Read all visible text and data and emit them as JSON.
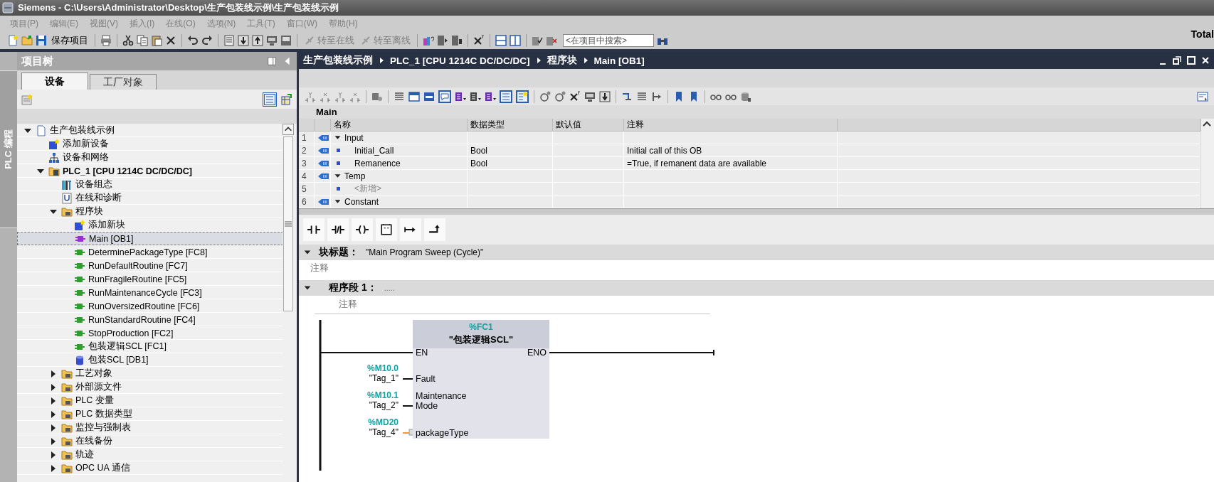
{
  "window": {
    "title": "Siemens  -  C:\\Users\\Administrator\\Desktop\\生产包装线示例\\生产包装线示例"
  },
  "menu": [
    {
      "label": "项目(P)",
      "disabled": true
    },
    {
      "label": "编辑(E)",
      "disabled": true
    },
    {
      "label": "视图(V)",
      "disabled": true
    },
    {
      "label": "插入(I)",
      "disabled": true
    },
    {
      "label": "在线(O)",
      "disabled": true
    },
    {
      "label": "选项(N)",
      "disabled": true
    },
    {
      "label": "工具(T)",
      "disabled": true
    },
    {
      "label": "窗口(W)",
      "disabled": true
    },
    {
      "label": "帮助(H)",
      "disabled": true
    }
  ],
  "toolbar": {
    "save_label": "保存项目",
    "buttons": [
      {
        "label": "转至在线",
        "disabled": true
      },
      {
        "label": "转至离线",
        "disabled": true
      }
    ],
    "search": {
      "placeholder": "<在项目中搜索>"
    },
    "right_label": "Total"
  },
  "side_tab": {
    "label": "PLC 编程"
  },
  "tree": {
    "title": "项目树",
    "tabs": [
      {
        "label": "设备",
        "selected": true
      },
      {
        "label": "工厂对象",
        "selected": false
      }
    ],
    "items": [
      {
        "label": "生产包装线示例",
        "kind": "project",
        "expanded": true,
        "selected": false,
        "children": [
          {
            "label": "添加新设备",
            "kind": "add",
            "selected": false
          },
          {
            "label": "设备和网络",
            "kind": "network",
            "selected": false
          },
          {
            "label": "PLC_1 [CPU 1214C DC/DC/DC]",
            "kind": "device",
            "expanded": true,
            "selected": false,
            "children": [
              {
                "label": "设备组态",
                "kind": "config",
                "selected": false
              },
              {
                "label": "在线和诊断",
                "kind": "diagnostics",
                "selected": false
              },
              {
                "label": "程序块",
                "kind": "folder",
                "expanded": true,
                "selected": false,
                "children": [
                  {
                    "label": "添加新块",
                    "kind": "add",
                    "selected": false
                  },
                  {
                    "label": "Main [OB1]",
                    "kind": "ob",
                    "selected": true
                  },
                  {
                    "label": "DeterminePackageType [FC8]",
                    "kind": "fc",
                    "selected": false
                  },
                  {
                    "label": "RunDefaultRoutine [FC7]",
                    "kind": "fc",
                    "selected": false
                  },
                  {
                    "label": "RunFragileRoutine [FC5]",
                    "kind": "fc",
                    "selected": false
                  },
                  {
                    "label": "RunMaintenanceCycle [FC3]",
                    "kind": "fc",
                    "selected": false
                  },
                  {
                    "label": "RunOversizedRoutine [FC6]",
                    "kind": "fc",
                    "selected": false
                  },
                  {
                    "label": "RunStandardRoutine [FC4]",
                    "kind": "fc",
                    "selected": false
                  },
                  {
                    "label": "StopProduction [FC2]",
                    "kind": "fc",
                    "selected": false
                  },
                  {
                    "label": "包装逻辑SCL [FC1]",
                    "kind": "fc",
                    "selected": false
                  },
                  {
                    "label": "包装SCL [DB1]",
                    "kind": "db",
                    "selected": false
                  }
                ]
              },
              {
                "label": "工艺对象",
                "kind": "folder",
                "expanded": false,
                "selected": false
              },
              {
                "label": "外部源文件",
                "kind": "folder",
                "expanded": false,
                "selected": false
              },
              {
                "label": "PLC 变量",
                "kind": "folder",
                "expanded": false,
                "selected": false
              },
              {
                "label": "PLC 数据类型",
                "kind": "folder",
                "expanded": false,
                "selected": false
              },
              {
                "label": "监控与强制表",
                "kind": "folder",
                "expanded": false,
                "selected": false
              },
              {
                "label": "在线备份",
                "kind": "folder",
                "expanded": false,
                "selected": false
              },
              {
                "label": "轨迹",
                "kind": "folder",
                "expanded": false,
                "selected": false
              },
              {
                "label": "OPC UA 通信",
                "kind": "folder",
                "expanded": false,
                "selected": false
              }
            ]
          }
        ]
      }
    ]
  },
  "editor": {
    "breadcrumb": [
      "生产包装线示例",
      "PLC_1 [CPU 1214C DC/DC/DC]",
      "程序块",
      "Main [OB1]"
    ],
    "interface": {
      "title": "Main",
      "columns": [
        "名称",
        "数据类型",
        "默认值",
        "注释"
      ],
      "rows": [
        {
          "index": "1",
          "kind": "section",
          "name": "Input",
          "expanded": true
        },
        {
          "index": "2",
          "kind": "var",
          "name": "Initial_Call",
          "type": "Bool",
          "comment": "Initial call of this OB"
        },
        {
          "index": "3",
          "kind": "var",
          "name": "Remanence",
          "type": "Bool",
          "comment": "=True, if remanent data are available"
        },
        {
          "index": "4",
          "kind": "section",
          "name": "Temp",
          "expanded": true
        },
        {
          "index": "5",
          "kind": "new",
          "name": "<新增>"
        },
        {
          "index": "6",
          "kind": "section",
          "name": "Constant",
          "expanded": true
        }
      ]
    },
    "block_title": {
      "label": "块标题：",
      "value": "\"Main Program Sweep (Cycle)\"",
      "comment": "注释",
      "expanded": true
    },
    "network": {
      "label": "程序段 1：",
      "title": ".....",
      "comment": "注释",
      "expanded": true,
      "box": {
        "address": "%FC1",
        "name": "\"包装逻辑SCL\"",
        "en": "EN",
        "eno": "ENO",
        "inputs": [
          {
            "address": "%M10.0",
            "tag": "\"Tag_1\"",
            "pin": "Fault",
            "conversion": false
          },
          {
            "address": "%M10.1",
            "tag": "\"Tag_2\"",
            "pin": "Maintenance Mode",
            "conversion": false
          },
          {
            "address": "%MD20",
            "tag": "\"Tag_4\"",
            "pin": "packageType",
            "conversion": true
          }
        ]
      }
    }
  }
}
